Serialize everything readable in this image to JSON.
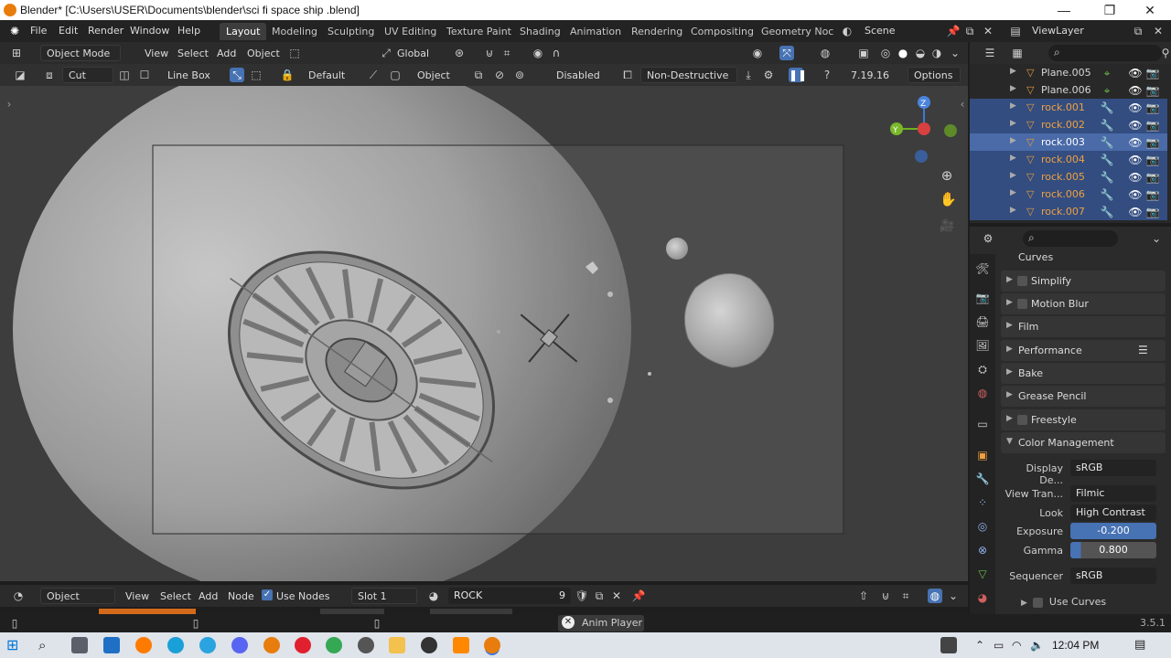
{
  "titlebar": {
    "title": "Blender* [C:\\Users\\USER\\Documents\\blender\\sci fi space ship .blend]",
    "minimize": "—",
    "maximize": "❐",
    "close": "✕"
  },
  "menu": {
    "items": [
      "File",
      "Edit",
      "Render",
      "Window",
      "Help"
    ]
  },
  "workspaces": {
    "tabs": [
      "Layout",
      "Modeling",
      "Sculpting",
      "UV Editing",
      "Texture Paint",
      "Shading",
      "Animation",
      "Rendering",
      "Compositing",
      "Geometry Noc"
    ]
  },
  "scene": {
    "label": "Scene",
    "viewlayer": "ViewLayer"
  },
  "viewport_header": {
    "mode": "Object Mode",
    "menus": [
      "View",
      "Select",
      "Add",
      "Object"
    ],
    "transform": "Global"
  },
  "tool_settings": {
    "tool": "Cut",
    "shape": "Line Box",
    "default": "Default",
    "object": "Object",
    "disabled": "Disabled",
    "nondestructive": "Non-Destructive",
    "version": "7.19.16",
    "options": "Options"
  },
  "outliner": {
    "rows": [
      {
        "name": "Plane.005",
        "selected": false,
        "active": false,
        "color": "#d8d8d8"
      },
      {
        "name": "Plane.006",
        "selected": false,
        "active": false,
        "color": "#d8d8d8"
      },
      {
        "name": "rock.001",
        "selected": true,
        "active": false,
        "color": "#f0a040"
      },
      {
        "name": "rock.002",
        "selected": true,
        "active": false,
        "color": "#f0a040"
      },
      {
        "name": "rock.003",
        "selected": true,
        "active": true,
        "color": "#ffffff"
      },
      {
        "name": "rock.004",
        "selected": true,
        "active": false,
        "color": "#f0a040"
      },
      {
        "name": "rock.005",
        "selected": true,
        "active": false,
        "color": "#f0a040"
      },
      {
        "name": "rock.006",
        "selected": true,
        "active": false,
        "color": "#f0a040"
      },
      {
        "name": "rock.007",
        "selected": true,
        "active": false,
        "color": "#f0a040"
      }
    ]
  },
  "properties": {
    "panels": [
      {
        "label": "Curves",
        "checkbox": false
      },
      {
        "label": "Simplify",
        "checkbox": true
      },
      {
        "label": "Motion Blur",
        "checkbox": true
      },
      {
        "label": "Film",
        "checkbox": false
      },
      {
        "label": "Performance",
        "checkbox": false
      },
      {
        "label": "Bake",
        "checkbox": false
      },
      {
        "label": "Grease Pencil",
        "checkbox": false
      },
      {
        "label": "Freestyle",
        "checkbox": true
      }
    ],
    "color_management": {
      "header": "Color Management",
      "display_label": "Display De...",
      "display_value": "sRGB",
      "view_label": "View Tran...",
      "view_value": "Filmic",
      "look_label": "Look",
      "look_value": "High Contrast",
      "exposure_label": "Exposure",
      "exposure_value": "-0.200",
      "gamma_label": "Gamma",
      "gamma_value": "0.800",
      "sequencer_label": "Sequencer",
      "sequencer_value": "sRGB",
      "use_curves": "Use Curves"
    }
  },
  "node_header": {
    "type": "Object",
    "menus": [
      "View",
      "Select",
      "Add",
      "Node"
    ],
    "use_nodes": "Use Nodes",
    "slot": "Slot 1",
    "material": "ROCK",
    "users": "9"
  },
  "status": {
    "anim_player": "Anim Player",
    "version": "3.5.1"
  },
  "taskbar": {
    "time": "12:04 PM"
  },
  "colors": {
    "accent": "#4772b3",
    "object_orange": "#e69a3c",
    "viewport_bg": "#3d3d3d"
  }
}
